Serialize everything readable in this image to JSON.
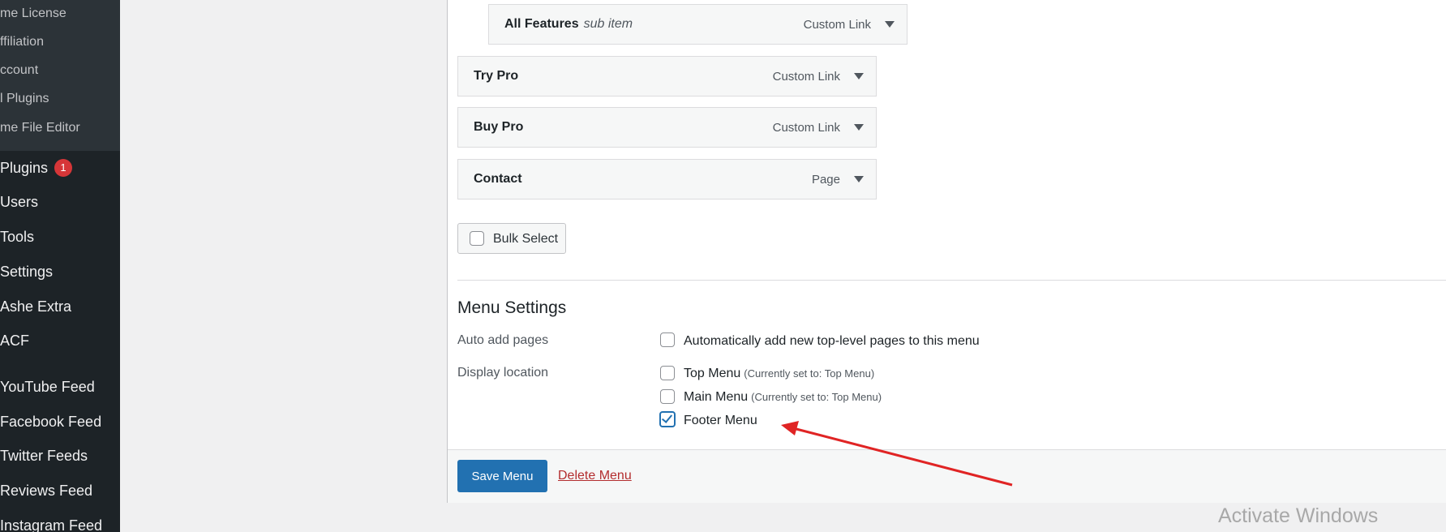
{
  "sidebar": {
    "submenu": [
      {
        "label": "me License"
      },
      {
        "label": "ffiliation"
      },
      {
        "label": "ccount"
      },
      {
        "label": "l Plugins"
      },
      {
        "label": "me File Editor"
      }
    ],
    "items": [
      {
        "label": "Plugins",
        "badge": "1"
      },
      {
        "label": "Users"
      },
      {
        "label": "Tools"
      },
      {
        "label": "Settings"
      },
      {
        "label": "Ashe Extra"
      },
      {
        "label": "ACF"
      },
      {
        "label": "YouTube Feed"
      },
      {
        "label": "Facebook Feed"
      },
      {
        "label": "Twitter Feeds"
      },
      {
        "label": "Reviews Feed"
      },
      {
        "label": "Instagram Feed"
      }
    ]
  },
  "menu_items": [
    {
      "title": "All Features",
      "sub": "sub item",
      "type": "Custom Link"
    },
    {
      "title": "Try Pro",
      "type": "Custom Link"
    },
    {
      "title": "Buy Pro",
      "type": "Custom Link"
    },
    {
      "title": "Contact",
      "type": "Page"
    }
  ],
  "bulk_select": {
    "label": "Bulk Select"
  },
  "menu_settings": {
    "heading": "Menu Settings",
    "auto_add_label": "Auto add pages",
    "auto_add_option": "Automatically add new top-level pages to this menu",
    "display_location_label": "Display location",
    "locations": [
      {
        "name": "Top Menu",
        "note": "(Currently set to: Top Menu)",
        "checked": false
      },
      {
        "name": "Main Menu",
        "note": "(Currently set to: Top Menu)",
        "checked": false
      },
      {
        "name": "Footer Menu",
        "note": "",
        "checked": true
      }
    ]
  },
  "actions": {
    "save": "Save Menu",
    "delete": "Delete Menu"
  },
  "watermark": "Activate Windows",
  "colors": {
    "primary": "#2271b1",
    "danger": "#b32d2e",
    "sidebar_bg": "#1d2327",
    "annotation_arrow": "#e02424"
  }
}
